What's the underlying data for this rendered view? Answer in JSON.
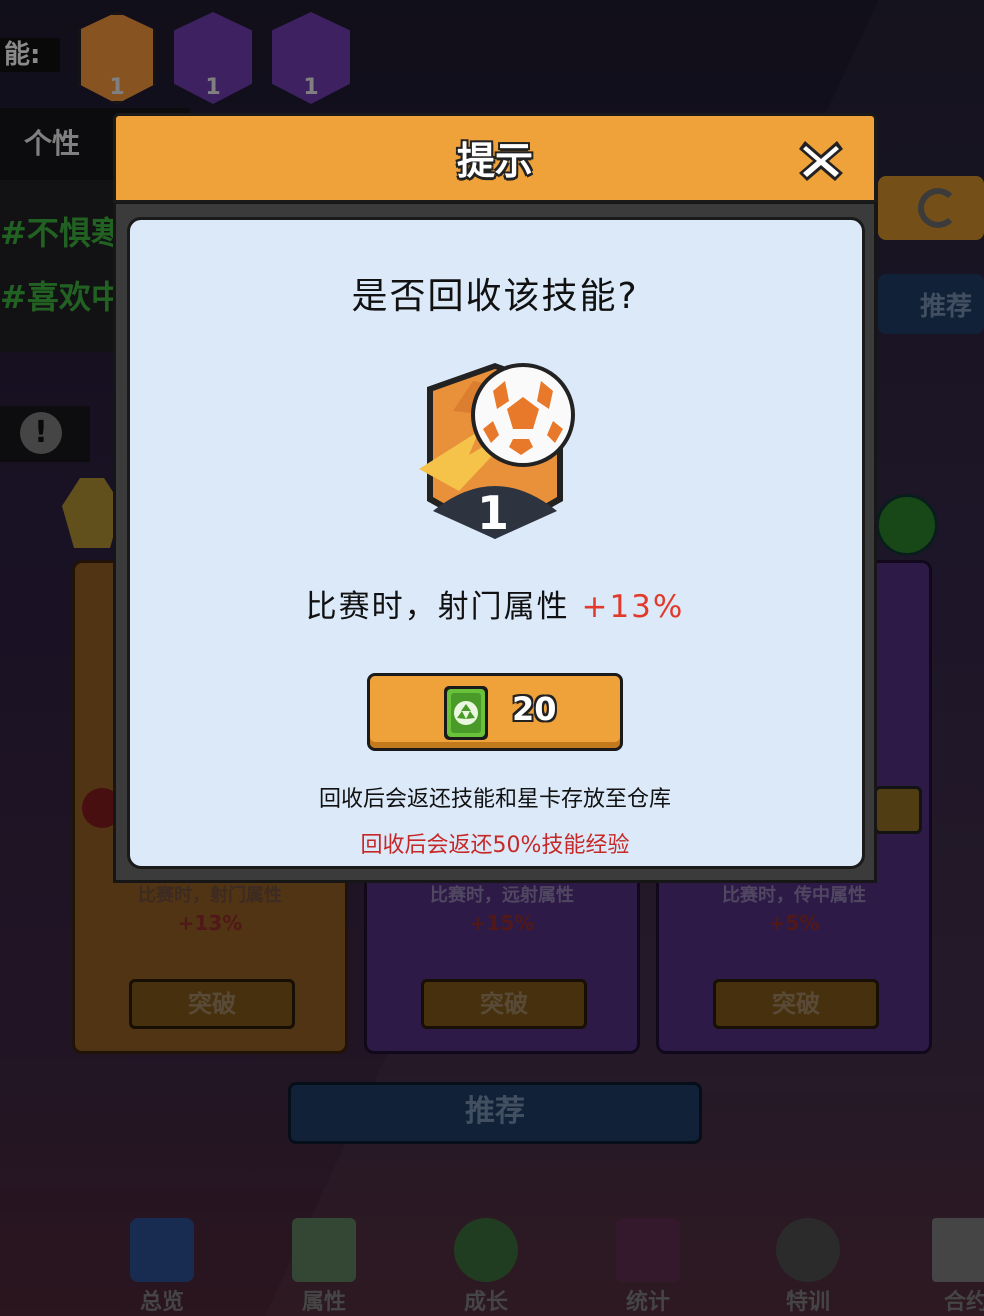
{
  "background": {
    "skills_label": "能:",
    "top_skills": [
      {
        "icon": "soccer-ball-icon",
        "level": "1",
        "color": "#e8913a"
      },
      {
        "icon": "player-kick-icon",
        "level": "1",
        "color": "#6a3aa8"
      },
      {
        "icon": "ball-trail-icon",
        "level": "1",
        "color": "#6a3aa8"
      }
    ],
    "personality_tab": "个性",
    "traits": [
      "#不惧寒",
      "#喜欢中"
    ],
    "recommend_side": "推荐",
    "cards": [
      {
        "desc": "比赛时，射门属性",
        "value": "+13%",
        "break_label": "突破",
        "color": "#e8913a"
      },
      {
        "desc": "比赛时，远射属性",
        "value": "+15%",
        "break_label": "突破",
        "color": "#7a4ab8"
      },
      {
        "desc": "比赛时，传中属性",
        "value": "+5%",
        "break_label": "突破",
        "color": "#7a4ab8"
      }
    ],
    "recommend_main": "推荐",
    "nav": [
      {
        "label": "总览",
        "icon": "overview-blocks-icon"
      },
      {
        "label": "属性",
        "icon": "attribute-calendar-icon"
      },
      {
        "label": "成长",
        "icon": "growth-arrow-icon"
      },
      {
        "label": "统计",
        "icon": "statistics-bars-icon"
      },
      {
        "label": "特训",
        "icon": "training-fireball-icon"
      },
      {
        "label": "合约",
        "icon": "contract-paper-icon"
      }
    ]
  },
  "dialog": {
    "title": "提示",
    "question": "是否回收该技能?",
    "skill": {
      "icon": "soccer-ball-badge-icon",
      "level": "1"
    },
    "effect_prefix": "比赛时，射门属性 ",
    "effect_value": "+13%",
    "recycle_cost": "20",
    "note_return": "回收后会返还技能和星卡存放至仓库",
    "note_exp": "回收后会返还50%技能经验",
    "colors": {
      "header": "#f0a23a",
      "body": "#dbe9f9",
      "highlight": "#e23a2a"
    }
  }
}
